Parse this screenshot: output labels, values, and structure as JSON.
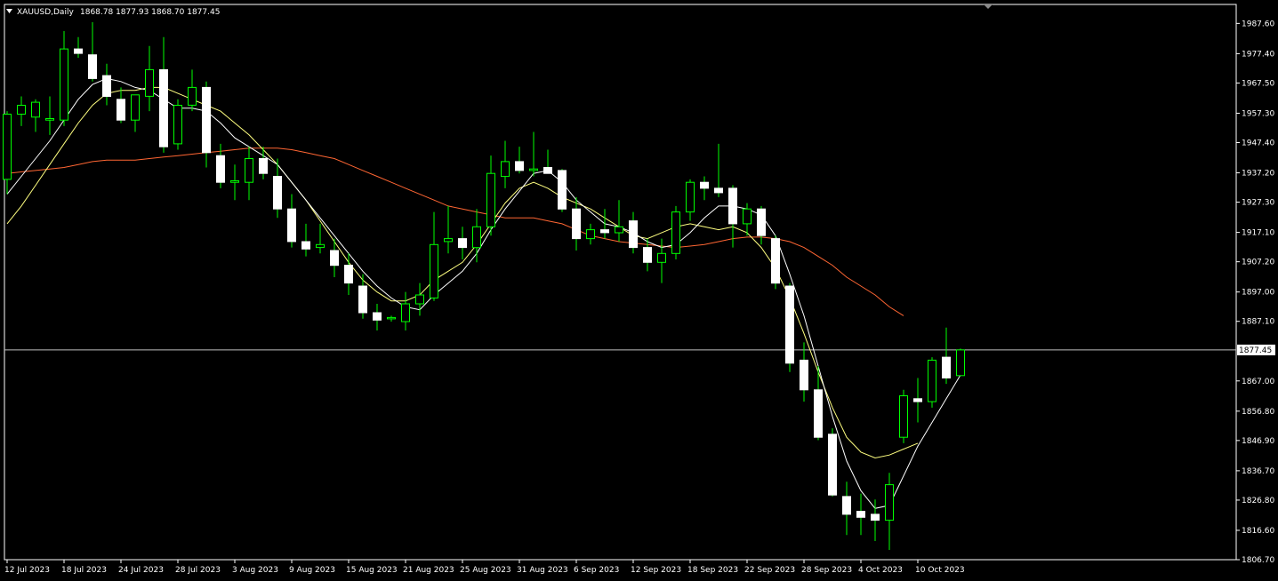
{
  "chart_header": {
    "symbol_label": "XAUUSD,Daily",
    "ohlc": "1868.78 1877.93 1868.70 1877.45"
  },
  "colors": {
    "background": "#000000",
    "frame": "#ffffff",
    "bull_body": "#000000",
    "bull_outline": "#00ff00",
    "bear_body": "#ffffff",
    "wick": "#00ff00",
    "ma_fast": "#ffffff",
    "ma_medium": "#ffff80",
    "ma_slow": "#ff6633",
    "price_line": "#c0c0c0"
  },
  "chart_data": {
    "type": "candlestick",
    "instrument": "XAUUSD",
    "timeframe": "Daily",
    "ylim": [
      1806.7,
      1994.0
    ],
    "y_ticks": [
      1987.6,
      1977.4,
      1967.5,
      1957.3,
      1947.4,
      1937.2,
      1927.3,
      1917.1,
      1907.2,
      1897.0,
      1887.1,
      1867.0,
      1856.8,
      1846.9,
      1836.7,
      1826.8,
      1816.6,
      1806.7
    ],
    "y_tick_labels": [
      "1987.60",
      "1977.40",
      "1967.50",
      "1957.30",
      "1947.40",
      "1937.20",
      "1927.30",
      "1917.10",
      "1907.20",
      "1897.00",
      "1887.10",
      "1867.00",
      "1856.80",
      "1846.90",
      "1836.70",
      "1826.80",
      "1816.60",
      "1806.70"
    ],
    "x_tick_labels": [
      "12 Jul 2023",
      "18 Jul 2023",
      "24 Jul 2023",
      "28 Jul 2023",
      "3 Aug 2023",
      "9 Aug 2023",
      "15 Aug 2023",
      "21 Aug 2023",
      "25 Aug 2023",
      "31 Aug 2023",
      "6 Sep 2023",
      "12 Sep 2023",
      "18 Sep 2023",
      "22 Sep 2023",
      "28 Sep 2023",
      "4 Oct 2023",
      "10 Oct 2023"
    ],
    "x_tick_bar_index": [
      0,
      4,
      8,
      12,
      16,
      20,
      24,
      28,
      32,
      36,
      40,
      44,
      48,
      52,
      56,
      60,
      64
    ],
    "current_price": 1877.45,
    "current_price_label": "1877.45",
    "candles": [
      {
        "o": 1935.0,
        "h": 1958.0,
        "l": 1930.0,
        "c": 1957.0
      },
      {
        "o": 1957.0,
        "h": 1963.0,
        "l": 1953.0,
        "c": 1960.0
      },
      {
        "o": 1956.0,
        "h": 1962.0,
        "l": 1951.0,
        "c": 1961.0
      },
      {
        "o": 1955.0,
        "h": 1963.0,
        "l": 1950.0,
        "c": 1955.5
      },
      {
        "o": 1955.0,
        "h": 1985.0,
        "l": 1953.0,
        "c": 1979.0
      },
      {
        "o": 1979.0,
        "h": 1983.0,
        "l": 1976.0,
        "c": 1977.5
      },
      {
        "o": 1977.0,
        "h": 1988.0,
        "l": 1968.0,
        "c": 1969.0
      },
      {
        "o": 1970.0,
        "h": 1974.0,
        "l": 1960.0,
        "c": 1963.0
      },
      {
        "o": 1962.0,
        "h": 1966.0,
        "l": 1954.0,
        "c": 1955.0
      },
      {
        "o": 1955.0,
        "h": 1963.0,
        "l": 1951.0,
        "c": 1963.5
      },
      {
        "o": 1963.0,
        "h": 1980.0,
        "l": 1958.0,
        "c": 1972.0
      },
      {
        "o": 1972.0,
        "h": 1983.0,
        "l": 1944.0,
        "c": 1946.0
      },
      {
        "o": 1947.0,
        "h": 1962.0,
        "l": 1945.0,
        "c": 1960.0
      },
      {
        "o": 1960.0,
        "h": 1972.0,
        "l": 1958.0,
        "c": 1966.0
      },
      {
        "o": 1966.0,
        "h": 1968.0,
        "l": 1939.0,
        "c": 1944.0
      },
      {
        "o": 1943.0,
        "h": 1947.0,
        "l": 1932.0,
        "c": 1934.0
      },
      {
        "o": 1934.0,
        "h": 1940.0,
        "l": 1928.0,
        "c": 1934.5
      },
      {
        "o": 1934.0,
        "h": 1946.0,
        "l": 1928.0,
        "c": 1942.0
      },
      {
        "o": 1942.0,
        "h": 1946.0,
        "l": 1935.0,
        "c": 1937.0
      },
      {
        "o": 1936.0,
        "h": 1942.0,
        "l": 1922.0,
        "c": 1925.0
      },
      {
        "o": 1925.0,
        "h": 1930.0,
        "l": 1912.0,
        "c": 1914.0
      },
      {
        "o": 1914.0,
        "h": 1920.0,
        "l": 1909.0,
        "c": 1911.5
      },
      {
        "o": 1912.0,
        "h": 1920.0,
        "l": 1910.0,
        "c": 1913.0
      },
      {
        "o": 1911.0,
        "h": 1915.0,
        "l": 1902.0,
        "c": 1906.0
      },
      {
        "o": 1906.0,
        "h": 1910.0,
        "l": 1896.0,
        "c": 1900.0
      },
      {
        "o": 1899.0,
        "h": 1903.0,
        "l": 1888.0,
        "c": 1890.0
      },
      {
        "o": 1890.0,
        "h": 1893.0,
        "l": 1884.0,
        "c": 1887.5
      },
      {
        "o": 1888.0,
        "h": 1889.0,
        "l": 1887.0,
        "c": 1888.4
      },
      {
        "o": 1887.0,
        "h": 1897.0,
        "l": 1884.0,
        "c": 1893.0
      },
      {
        "o": 1893.0,
        "h": 1900.0,
        "l": 1889.0,
        "c": 1896.0
      },
      {
        "o": 1895.0,
        "h": 1924.0,
        "l": 1894.0,
        "c": 1913.0
      },
      {
        "o": 1914.0,
        "h": 1926.0,
        "l": 1910.0,
        "c": 1915.0
      },
      {
        "o": 1915.0,
        "h": 1919.0,
        "l": 1908.0,
        "c": 1912.0
      },
      {
        "o": 1912.0,
        "h": 1925.0,
        "l": 1907.0,
        "c": 1919.0
      },
      {
        "o": 1919.0,
        "h": 1943.0,
        "l": 1916.0,
        "c": 1937.0
      },
      {
        "o": 1936.0,
        "h": 1948.0,
        "l": 1932.0,
        "c": 1941.0
      },
      {
        "o": 1941.0,
        "h": 1946.0,
        "l": 1937.0,
        "c": 1938.0
      },
      {
        "o": 1938.0,
        "h": 1951.0,
        "l": 1936.0,
        "c": 1938.5
      },
      {
        "o": 1939.0,
        "h": 1945.0,
        "l": 1937.0,
        "c": 1937.0
      },
      {
        "o": 1938.0,
        "h": 1938.5,
        "l": 1924.0,
        "c": 1925.0
      },
      {
        "o": 1925.0,
        "h": 1929.0,
        "l": 1911.0,
        "c": 1915.0
      },
      {
        "o": 1915.0,
        "h": 1920.0,
        "l": 1913.0,
        "c": 1918.0
      },
      {
        "o": 1918.0,
        "h": 1925.0,
        "l": 1915.0,
        "c": 1917.0
      },
      {
        "o": 1917.0,
        "h": 1928.0,
        "l": 1914.0,
        "c": 1919.0
      },
      {
        "o": 1921.0,
        "h": 1924.0,
        "l": 1910.0,
        "c": 1912.0
      },
      {
        "o": 1912.0,
        "h": 1915.0,
        "l": 1904.0,
        "c": 1907.0
      },
      {
        "o": 1907.0,
        "h": 1915.0,
        "l": 1900.0,
        "c": 1910.0
      },
      {
        "o": 1910.0,
        "h": 1926.0,
        "l": 1908.0,
        "c": 1924.0
      },
      {
        "o": 1924.0,
        "h": 1935.0,
        "l": 1921.0,
        "c": 1934.0
      },
      {
        "o": 1934.0,
        "h": 1936.0,
        "l": 1928.0,
        "c": 1932.0
      },
      {
        "o": 1932.0,
        "h": 1947.0,
        "l": 1929.0,
        "c": 1930.5
      },
      {
        "o": 1932.0,
        "h": 1933.0,
        "l": 1912.0,
        "c": 1920.0
      },
      {
        "o": 1920.0,
        "h": 1927.0,
        "l": 1916.0,
        "c": 1925.0
      },
      {
        "o": 1925.0,
        "h": 1926.0,
        "l": 1913.0,
        "c": 1916.0
      },
      {
        "o": 1915.0,
        "h": 1916.0,
        "l": 1898.0,
        "c": 1900.0
      },
      {
        "o": 1899.0,
        "h": 1900.0,
        "l": 1870.0,
        "c": 1873.0
      },
      {
        "o": 1874.0,
        "h": 1880.0,
        "l": 1860.0,
        "c": 1864.0
      },
      {
        "o": 1864.0,
        "h": 1872.0,
        "l": 1847.0,
        "c": 1848.0
      },
      {
        "o": 1849.0,
        "h": 1851.0,
        "l": 1828.0,
        "c": 1828.5
      },
      {
        "o": 1828.0,
        "h": 1833.0,
        "l": 1815.0,
        "c": 1822.0
      },
      {
        "o": 1823.0,
        "h": 1829.0,
        "l": 1815.0,
        "c": 1821.0
      },
      {
        "o": 1822.0,
        "h": 1827.0,
        "l": 1813.0,
        "c": 1820.0
      },
      {
        "o": 1820.0,
        "h": 1836.0,
        "l": 1810.0,
        "c": 1832.0
      },
      {
        "o": 1848.0,
        "h": 1864.0,
        "l": 1846.0,
        "c": 1862.0
      },
      {
        "o": 1861.0,
        "h": 1868.0,
        "l": 1853.0,
        "c": 1860.0
      },
      {
        "o": 1860.0,
        "h": 1875.0,
        "l": 1858.0,
        "c": 1874.0
      },
      {
        "o": 1875.0,
        "h": 1885.0,
        "l": 1866.0,
        "c": 1868.0
      },
      {
        "o": 1868.78,
        "h": 1877.93,
        "l": 1868.7,
        "c": 1877.45
      }
    ],
    "ma_fast": [
      1930.0,
      1936.0,
      1942.0,
      1948.0,
      1955.0,
      1962.0,
      1967.0,
      1969.0,
      1968.0,
      1966.0,
      1965.0,
      1962.0,
      1959.0,
      1959.0,
      1958.0,
      1954.0,
      1949.0,
      1946.0,
      1943.0,
      1940.0,
      1934.0,
      1928.0,
      1922.0,
      1916.0,
      1910.0,
      1904.0,
      1899.0,
      1895.0,
      1892.0,
      1891.0,
      1896.0,
      1900.0,
      1904.0,
      1910.0,
      1918.0,
      1925.0,
      1931.0,
      1937.0,
      1938.0,
      1934.0,
      1928.0,
      1924.0,
      1920.0,
      1919.0,
      1917.0,
      1914.0,
      1912.0,
      1913.0,
      1917.0,
      1922.0,
      1926.0,
      1926.0,
      1925.0,
      1923.0,
      1916.0,
      1903.0,
      1889.0,
      1872.0,
      1855.0,
      1840.0,
      1830.0,
      1824.0,
      1825.0,
      1835.0,
      1845.0,
      1853.0,
      1861.0,
      1869.0
    ],
    "ma_medium": [
      1920.0,
      1926.0,
      1933.0,
      1940.0,
      1947.0,
      1954.0,
      1960.0,
      1964.0,
      1965.0,
      1965.0,
      1966.0,
      1966.0,
      1964.0,
      1962.0,
      1960.0,
      1958.0,
      1954.0,
      1950.0,
      1945.0,
      1940.0,
      1934.0,
      1928.0,
      1921.0,
      1914.0,
      1907.0,
      1901.0,
      1897.0,
      1894.0,
      1894.0,
      1896.0,
      1901.0,
      1904.0,
      1907.0,
      1913.0,
      1920.0,
      1927.0,
      1932.0,
      1934.0,
      1932.0,
      1929.0,
      1927.0,
      1925.0,
      1922.0,
      1919.0,
      1916.0,
      1915.0,
      1917.0,
      1919.0,
      1920.0,
      1919.0,
      1918.0,
      1919.0,
      1917.0,
      1912.0,
      1905.0,
      1895.0,
      1883.0,
      1870.0,
      1858.0,
      1848.0,
      1843.0,
      1841.0,
      1842.0,
      1844.0,
      1846.0
    ],
    "ma_slow": [
      1937.0,
      1937.5,
      1938.0,
      1938.5,
      1939.0,
      1940.0,
      1941.0,
      1941.5,
      1941.5,
      1941.5,
      1942.0,
      1942.5,
      1943.0,
      1943.5,
      1944.0,
      1944.5,
      1945.0,
      1945.5,
      1945.5,
      1945.5,
      1945.0,
      1944.0,
      1943.0,
      1942.0,
      1940.0,
      1938.0,
      1936.0,
      1934.0,
      1932.0,
      1930.0,
      1928.0,
      1926.0,
      1925.0,
      1924.0,
      1923.0,
      1922.0,
      1922.0,
      1922.0,
      1921.0,
      1920.0,
      1918.0,
      1916.0,
      1915.0,
      1914.0,
      1913.5,
      1913.0,
      1912.5,
      1912.0,
      1912.5,
      1913.0,
      1914.0,
      1915.0,
      1915.5,
      1915.5,
      1915.0,
      1914.0,
      1912.0,
      1909.0,
      1906.0,
      1902.0,
      1899.0,
      1896.0,
      1892.0,
      1889.0
    ]
  }
}
